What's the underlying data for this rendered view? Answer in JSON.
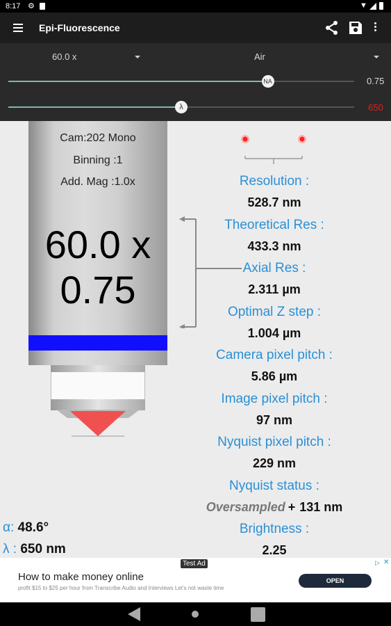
{
  "status": {
    "time": "8:17"
  },
  "appbar": {
    "title": "Epi-Fluorescence"
  },
  "controls": {
    "objective": "60.0 x",
    "medium": "Air",
    "na_value": "0.75",
    "na_fraction": 0.75,
    "na_thumb": "NA",
    "wavelength_value": "650",
    "wavelength_fraction": 0.5,
    "wavelength_thumb": "λ",
    "wavelength_color": "#e02020"
  },
  "objective": {
    "camera": "Cam:202 Mono",
    "binning": "Binning :1",
    "add_mag": "Add. Mag :1.0x",
    "magnification": "60.0 x",
    "na": "0.75",
    "band_color": "#1010ff"
  },
  "results": [
    {
      "label": "Resolution :",
      "value": "528.7 nm"
    },
    {
      "label": "Theoretical Res :",
      "value": "433.3 nm"
    },
    {
      "label": "Axial Res :",
      "value": "2.311  µm"
    },
    {
      "label": "Optimal Z step :",
      "value": "1.004 µm"
    },
    {
      "label": "Camera pixel pitch :",
      "value": "5.86 µm"
    },
    {
      "label": "Image pixel pitch :",
      "value": "97 nm"
    },
    {
      "label": "Nyquist pixel pitch :",
      "value": "229 nm"
    },
    {
      "label": "Nyquist status :",
      "status": "Oversampled",
      "plus": "+",
      "delta": "131 nm"
    },
    {
      "label": "Brightness :",
      "value": "2.25"
    }
  ],
  "angle": {
    "symbol": "α:",
    "value": "48.6°"
  },
  "wavelength": {
    "symbol": "λ :",
    "value": "650 nm"
  },
  "ad": {
    "badge": "Test Ad",
    "title": "How to make money online",
    "subtitle": "profit $15 to $25 per hour from Transcribe Audio and Interviews Let's not waste time",
    "button": "OPEN"
  }
}
